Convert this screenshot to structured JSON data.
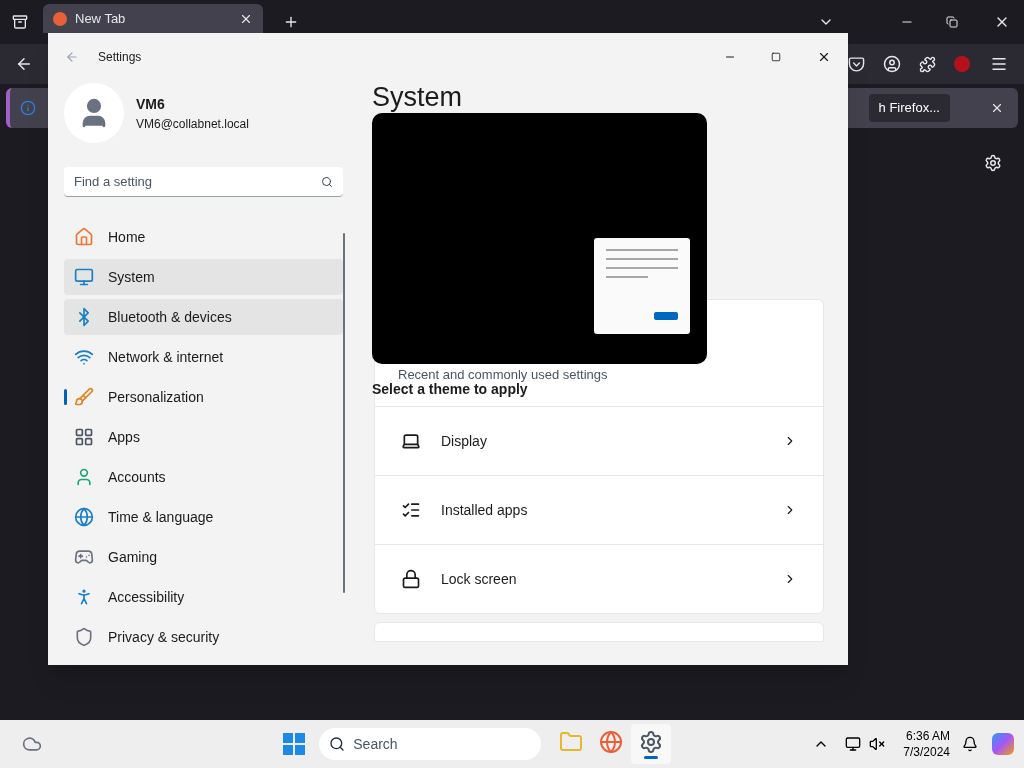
{
  "browser": {
    "tab": {
      "title": "New Tab"
    },
    "notification": {
      "button": "h Firefox..."
    }
  },
  "settings": {
    "title": "Settings",
    "user": {
      "name": "VM6",
      "email": "VM6@collabnet.local"
    },
    "search": {
      "placeholder": "Find a setting"
    },
    "nav": [
      {
        "label": "Home",
        "selected": false,
        "hover": false
      },
      {
        "label": "System",
        "selected": false,
        "hover": true
      },
      {
        "label": "Bluetooth & devices",
        "selected": false,
        "hover": true
      },
      {
        "label": "Network & internet",
        "selected": false,
        "hover": false
      },
      {
        "label": "Personalization",
        "selected": true,
        "hover": false
      },
      {
        "label": "Apps",
        "selected": false,
        "hover": false
      },
      {
        "label": "Accounts",
        "selected": false,
        "hover": false
      },
      {
        "label": "Time & language",
        "selected": false,
        "hover": false
      },
      {
        "label": "Gaming",
        "selected": false,
        "hover": false
      },
      {
        "label": "Accessibility",
        "selected": false,
        "hover": false
      },
      {
        "label": "Privacy & security",
        "selected": false,
        "hover": false
      }
    ],
    "page_title": "System",
    "caption": "Recent and commonly used settings",
    "theme_label": "Select a theme to apply",
    "rows": [
      {
        "label": "Display"
      },
      {
        "label": "Installed apps"
      },
      {
        "label": "Lock screen"
      }
    ]
  },
  "taskbar": {
    "search_placeholder": "Search",
    "time": "6:36 AM",
    "date": "7/3/2024",
    "apps": [
      {
        "active": false
      },
      {
        "active": false
      },
      {
        "active": true
      }
    ]
  }
}
